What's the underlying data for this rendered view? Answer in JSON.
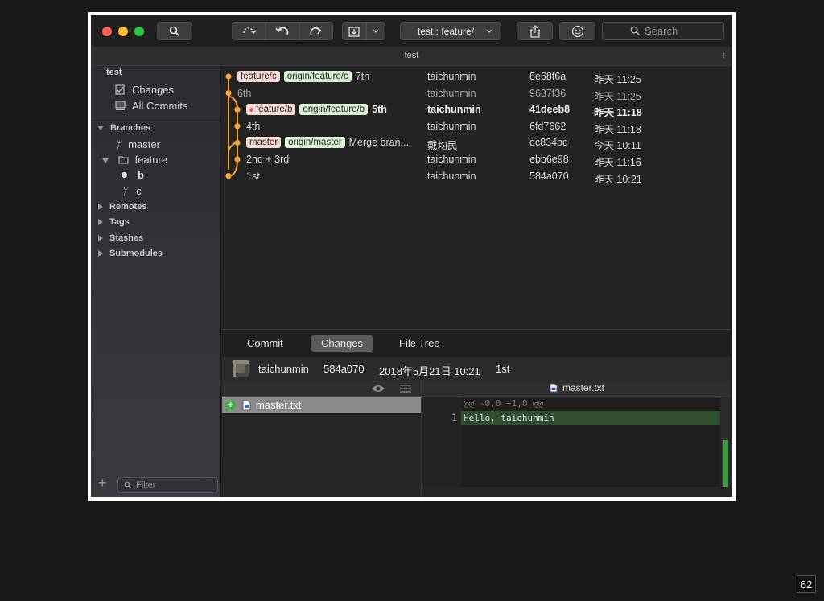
{
  "toolbar": {
    "branch_selector": "test :  feature/",
    "search_placeholder": "Search"
  },
  "window": {
    "title": "test"
  },
  "sidebar": {
    "repo": "test",
    "changes": "Changes",
    "all_commits": "All Commits",
    "branches_label": "Branches",
    "branch_master": "master",
    "branch_feature": "feature",
    "branch_b": "b",
    "branch_c": "c",
    "remotes": "Remotes",
    "tags": "Tags",
    "stashes": "Stashes",
    "submodules": "Submodules",
    "filter_placeholder": "Filter"
  },
  "commits": [
    {
      "tags": [
        {
          "label": "feature/c",
          "kind": "local"
        },
        {
          "label": "origin/feature/c",
          "kind": "remote"
        }
      ],
      "message": "7th",
      "author": "taichunmin",
      "hash": "8e68f6a",
      "date": "昨天 11:25"
    },
    {
      "tags": [],
      "message": "6th",
      "author": "taichunmin",
      "hash": "9637f36",
      "date": "昨天 11:25"
    },
    {
      "tags": [
        {
          "label": "feature/b",
          "kind": "local"
        },
        {
          "label": "origin/feature/b",
          "kind": "remote"
        }
      ],
      "message": "5th",
      "author": "taichunmin",
      "hash": "41deeb8",
      "date": "昨天 11:18"
    },
    {
      "tags": [],
      "message": "4th",
      "author": "taichunmin",
      "hash": "6fd7662",
      "date": "昨天 11:18"
    },
    {
      "tags": [
        {
          "label": "master",
          "kind": "local"
        },
        {
          "label": "origin/master",
          "kind": "remote"
        }
      ],
      "message": "Merge bran...",
      "author": "戴均民",
      "hash": "dc834bd",
      "date": "今天 10:11"
    },
    {
      "tags": [],
      "message": "2nd + 3rd",
      "author": "taichunmin",
      "hash": "ebb6e98",
      "date": "昨天 11:16"
    },
    {
      "tags": [],
      "message": "1st",
      "author": "taichunmin",
      "hash": "584a070",
      "date": "昨天 10:21"
    }
  ],
  "tabs": {
    "commit": "Commit",
    "changes": "Changes",
    "file_tree": "File Tree"
  },
  "summary": {
    "author": "taichunmin",
    "hash": "584a070",
    "date": "2018年5月21日 10:21",
    "message": "1st"
  },
  "files": {
    "file": "master.txt"
  },
  "diff": {
    "filename": "master.txt",
    "hunk": "@@ -0,0 +1,0 @@",
    "line_no": "1",
    "line_text": "Hello, taichunmin"
  },
  "page_number": "62",
  "colors": {
    "graph": "#f0a43a",
    "local_tag": "#f5d9d4",
    "remote_tag": "#d9f1d3",
    "added_line": "#2d4e2f"
  }
}
